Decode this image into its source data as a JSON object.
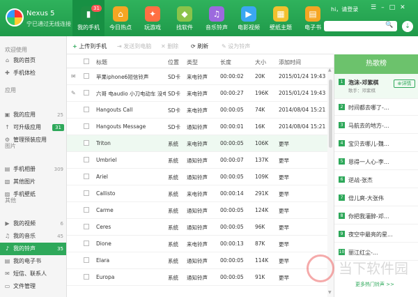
{
  "device": {
    "name": "Nexus 5",
    "subtitle": "宁已通过无线连接"
  },
  "nav": [
    {
      "label": "我的手机",
      "icon": "phone-icon",
      "color": "#1e8f44",
      "badge": "31"
    },
    {
      "label": "今日热点",
      "icon": "home-icon",
      "color": "#f5a623"
    },
    {
      "label": "玩游戏",
      "icon": "gamepad-icon",
      "color": "#ff7043"
    },
    {
      "label": "找软件",
      "icon": "android-icon",
      "color": "#8bc34a"
    },
    {
      "label": "音乐铃声",
      "icon": "music-icon",
      "color": "#9c6ade"
    },
    {
      "label": "电影视频",
      "icon": "play-icon",
      "color": "#3ba7f2"
    },
    {
      "label": "壁纸主题",
      "icon": "wallpaper-icon",
      "color": "#f2c12e"
    },
    {
      "label": "电子书",
      "icon": "book-icon",
      "color": "#f5a623"
    }
  ],
  "user": {
    "greeting": "hi，请登录"
  },
  "sidebar": {
    "sections": [
      "欢迎使用",
      "应用",
      "图片",
      "其他"
    ],
    "items": [
      {
        "label": "我的首页",
        "count": ""
      },
      {
        "label": "手机体检",
        "count": ""
      },
      {
        "label": "我的应用",
        "count": "25"
      },
      {
        "label": "可升级应用",
        "count": "31"
      },
      {
        "label": "管理预装应用",
        "count": ""
      },
      {
        "label": "手机相册",
        "count": "309"
      },
      {
        "label": "其他图片",
        "count": ""
      },
      {
        "label": "手机壁纸",
        "count": ""
      },
      {
        "label": "我的视频",
        "count": "6"
      },
      {
        "label": "我的音乐",
        "count": "45"
      },
      {
        "label": "我的铃声",
        "count": "35"
      },
      {
        "label": "我的电子书",
        "count": ""
      },
      {
        "label": "短信、联系人",
        "count": ""
      },
      {
        "label": "文件管理",
        "count": ""
      }
    ]
  },
  "toolbar": {
    "upload": "上传到手机",
    "send": "发送到电脑",
    "delete": "删除",
    "refresh": "刷新",
    "set": "设为铃声"
  },
  "table": {
    "headers": [
      "标题",
      "位置",
      "类型",
      "长度",
      "大小",
      "添加时间"
    ],
    "rows": [
      [
        "苹果iphone6短信铃声",
        "SD卡",
        "来电铃声",
        "00:00:02",
        "20K",
        "2015/01/24 19:43"
      ],
      [
        "六哥 电audio 小刀电动车 没电还...",
        "SD卡",
        "来电铃声",
        "00:00:27",
        "196K",
        "2015/01/24 19:43"
      ],
      [
        "Hangouts Call",
        "SD卡",
        "来电铃声",
        "00:00:05",
        "74K",
        "2014/08/04 15:21"
      ],
      [
        "Hangouts Message",
        "SD卡",
        "通知铃声",
        "00:00:01",
        "16K",
        "2014/08/04 15:21"
      ],
      [
        "Triton",
        "系统",
        "来电铃声",
        "00:00:05",
        "106K",
        "更早"
      ],
      [
        "Umbriel",
        "系统",
        "通知铃声",
        "00:00:07",
        "137K",
        "更早"
      ],
      [
        "Ariel",
        "系统",
        "通知铃声",
        "00:00:05",
        "109K",
        "更早"
      ],
      [
        "Callisto",
        "系统",
        "来电铃声",
        "00:00:14",
        "291K",
        "更早"
      ],
      [
        "Carme",
        "系统",
        "通知铃声",
        "00:00:05",
        "124K",
        "更早"
      ],
      [
        "Ceres",
        "系统",
        "通知铃声",
        "00:00:05",
        "96K",
        "更早"
      ],
      [
        "Dione",
        "系统",
        "来电铃声",
        "00:00:13",
        "87K",
        "更早"
      ],
      [
        "Elara",
        "系统",
        "通知铃声",
        "00:00:05",
        "114K",
        "更早"
      ],
      [
        "Europa",
        "系统",
        "通知铃声",
        "00:00:05",
        "91K",
        "更早"
      ]
    ]
  },
  "hot": {
    "title": "热歌榜",
    "top": {
      "rank": "1",
      "title": "泡沫-邓紫棋",
      "singer": "歌手：邓紫棋",
      "detail": "详情"
    },
    "items": [
      {
        "rank": "2",
        "title": "时间都去哪了-..."
      },
      {
        "rank": "3",
        "title": "马航去的地方-..."
      },
      {
        "rank": "4",
        "title": "宝贝去哪儿-魏..."
      },
      {
        "rank": "5",
        "title": "恩得一人心-李..."
      },
      {
        "rank": "6",
        "title": "逆战-张杰"
      },
      {
        "rank": "7",
        "title": "倍儿爽-大张伟"
      },
      {
        "rank": "8",
        "title": "你把我灌醉-邓..."
      },
      {
        "rank": "9",
        "title": "夜空中最亮的星..."
      },
      {
        "rank": "10",
        "title": "丽江红尘-..."
      }
    ],
    "more": "更多热门铃声 >>"
  },
  "watermark": {
    "text": "当下软件园"
  }
}
